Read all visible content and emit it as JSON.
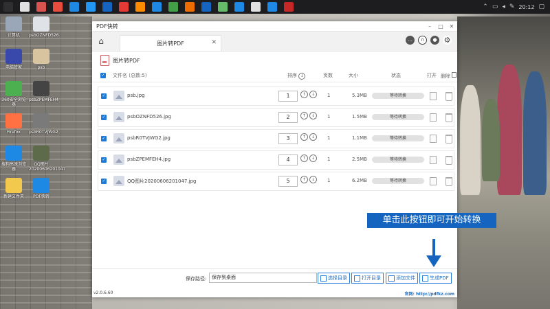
{
  "taskbar": {
    "time": "20:12",
    "app_colors": [
      "#2f2f2f",
      "#e0e0e0",
      "#d9534f",
      "#e74c3c",
      "#1e88e5",
      "#2196f3",
      "#1565c0",
      "#e53935",
      "#fb8c00",
      "#1e88e5",
      "#43a047",
      "#ef6c00",
      "#1565c0",
      "#66bb6a",
      "#1e88e5",
      "#e0e0e0",
      "#1e88e5",
      "#c62828"
    ]
  },
  "desktop_icons": [
    {
      "label": "计算机",
      "color": "#9aa7b8"
    },
    {
      "label": "psbOZNFD526",
      "color": "#dfe3e8"
    },
    {
      "label": "电脑管家",
      "color": "#3949ab"
    },
    {
      "label": "psb",
      "color": "#d9c4a0"
    },
    {
      "label": "360安全浏览器",
      "color": "#4caf50"
    },
    {
      "label": "psbZPEMFEH4",
      "color": "#444"
    },
    {
      "label": "Firefox",
      "color": "#ff7043"
    },
    {
      "label": "psbR0TVJWG2",
      "color": "#7a7a7a"
    },
    {
      "label": "搜狗高速浏览器",
      "color": "#1e88e5"
    },
    {
      "label": "QQ图片20200606201047",
      "color": "#5d6b4a"
    },
    {
      "label": "新建文件夹",
      "color": "#f2c94c"
    },
    {
      "label": "PDF快转",
      "color": "#1e88e5"
    }
  ],
  "window": {
    "title": "PDF快转",
    "tab_label": "图片转PDF",
    "section_title": "图片转PDF",
    "headers": {
      "filename": "文件名 (总数:5)",
      "order": "排序",
      "pages": "页数",
      "size": "大小",
      "status": "状态",
      "open": "打开",
      "delete": "删除"
    },
    "rows": [
      {
        "name": "psb.jpg",
        "order": "1",
        "pages": "1",
        "size": "5.3MB",
        "status": "等待转换"
      },
      {
        "name": "psbOZNFD526.jpg",
        "order": "2",
        "pages": "1",
        "size": "1.5MB",
        "status": "等待转换"
      },
      {
        "name": "psbR0TVJWG2.jpg",
        "order": "3",
        "pages": "1",
        "size": "1.1MB",
        "status": "等待转换"
      },
      {
        "name": "psbZPEMFEH4.jpg",
        "order": "4",
        "pages": "1",
        "size": "2.5MB",
        "status": "等待转换"
      },
      {
        "name": "QQ图片20200606201047.jpg",
        "order": "5",
        "pages": "1",
        "size": "6.2MB",
        "status": "等待转换"
      }
    ],
    "save_label": "保存路径:",
    "save_value": "保存到桌面",
    "buttons": {
      "choose_dir": "选择目录",
      "open_dir": "打开目录",
      "add_file": "添加文件",
      "generate_pdf": "生成PDF"
    },
    "version": "v2.0.6.60",
    "website": "官网: http://pdfkz.com"
  },
  "overlay": {
    "hint_text": "单击此按钮即可开始转换",
    "hint_color": "#1565c0"
  }
}
